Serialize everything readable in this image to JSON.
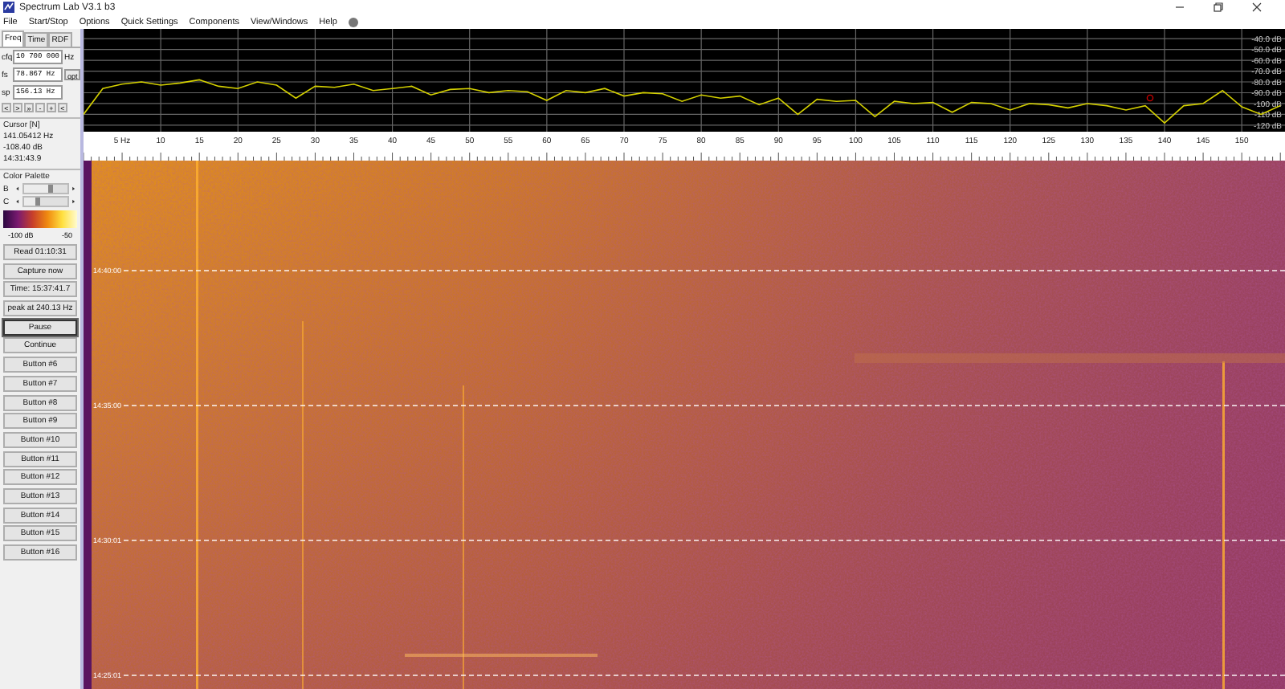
{
  "window": {
    "title": "Spectrum Lab V3.1 b3"
  },
  "menu": [
    "File",
    "Start/Stop",
    "Options",
    "Quick Settings",
    "Components",
    "View/Windows",
    "Help"
  ],
  "left_panel": {
    "tabs": [
      {
        "label": "Freq",
        "selected": true
      },
      {
        "label": "Time",
        "selected": false
      },
      {
        "label": "RDF",
        "selected": false
      }
    ],
    "fields": [
      {
        "label": "cfq",
        "value": "10 700 000",
        "suffix": "Hz"
      },
      {
        "label": "fs",
        "value": "78.867 Hz",
        "button": "opt"
      },
      {
        "label": "sp",
        "value": "156.13 Hz"
      }
    ],
    "nav_buttons": [
      "<",
      ">",
      "»",
      "-",
      "+",
      "<"
    ],
    "cursor": {
      "title": "Cursor [N]",
      "lines": [
        "141.05412 Hz",
        "-108.40 dB",
        "14:31:43.9"
      ]
    },
    "color_palette": {
      "title": "Color Palette",
      "sliders": [
        {
          "label": "B",
          "level": 0.68
        },
        {
          "label": "C",
          "level": 0.36
        }
      ],
      "scale_min": "-100 dB",
      "scale_max": "-50"
    },
    "buttons": [
      {
        "label": "Read 01:10:31",
        "default": false
      },
      {
        "label": "Capture now",
        "default": false
      },
      {
        "label": "Time:  15:37:41.7",
        "default": false
      },
      {
        "label": "peak at 240.13 Hz",
        "default": false
      },
      {
        "label": "Pause",
        "default": true
      },
      {
        "label": "Continue",
        "default": false
      },
      {
        "label": "Button #6",
        "default": false
      },
      {
        "label": "Button #7",
        "default": false
      },
      {
        "label": "Button #8",
        "default": false
      },
      {
        "label": "Button #9",
        "default": false
      },
      {
        "label": "Button #10",
        "default": false
      },
      {
        "label": "Button #11",
        "default": false
      },
      {
        "label": "Button #12",
        "default": false
      },
      {
        "label": "Button #13",
        "default": false
      },
      {
        "label": "Button #14",
        "default": false
      },
      {
        "label": "Button #15",
        "default": false
      },
      {
        "label": "Button #16",
        "default": false
      }
    ]
  },
  "spectrum": {
    "chart_data": {
      "type": "line",
      "x": [
        0,
        2.5,
        5,
        7.5,
        10,
        12.5,
        15,
        17.5,
        20,
        22.5,
        25,
        27.5,
        30,
        32.5,
        35,
        37.5,
        40,
        42.5,
        45,
        47.5,
        50,
        52.5,
        55,
        57.5,
        60,
        62.5,
        65,
        67.5,
        70,
        72.5,
        75,
        77.5,
        80,
        82.5,
        85,
        87.5,
        90,
        92.5,
        95,
        97.5,
        100,
        102.5,
        105,
        107.5,
        110,
        112.5,
        115,
        117.5,
        120,
        122.5,
        125,
        127.5,
        130,
        132.5,
        135,
        137.5,
        140,
        142.5,
        145,
        147.5,
        150,
        152.5,
        155
      ],
      "series": [
        {
          "color": "#d4d000",
          "values": [
            -110,
            -86,
            -82,
            -80,
            -83,
            -81,
            -78,
            -84,
            -86,
            -80,
            -83,
            -95,
            -84,
            -85,
            -82,
            -88,
            -86,
            -84,
            -92,
            -87,
            -86,
            -90,
            -88,
            -89,
            -97,
            -88,
            -90,
            -86,
            -93,
            -90,
            -91,
            -98,
            -92,
            -95,
            -93,
            -101,
            -95,
            -110,
            -96,
            -98,
            -97,
            -112,
            -98,
            -100,
            -99,
            -108,
            -99,
            -100,
            -106,
            -100,
            -101,
            -104,
            -100,
            -102,
            -106,
            -102,
            -118,
            -102,
            -100,
            -88,
            -103,
            -110,
            -102
          ]
        }
      ],
      "xlim": [
        0,
        155.6
      ],
      "ylim": [
        -126,
        -31
      ],
      "grid": true,
      "xticks": [
        {
          "value": 5,
          "label": "5 Hz"
        },
        10,
        15,
        20,
        25,
        30,
        35,
        40,
        45,
        50,
        55,
        60,
        65,
        70,
        75,
        80,
        85,
        90,
        95,
        100,
        105,
        110,
        115,
        120,
        125,
        130,
        135,
        140,
        145,
        150
      ],
      "yticks": [
        {
          "value": -40,
          "label": "-40.0 dB"
        },
        {
          "value": -50,
          "label": "-50.0 dB"
        },
        {
          "value": -60,
          "label": "-60.0 dB"
        },
        {
          "value": -70,
          "label": "-70.0 dB"
        },
        {
          "value": -80,
          "label": "-80.0 dB"
        },
        {
          "value": -90,
          "label": "-90.0 dB"
        },
        {
          "value": -100,
          "label": "-100 dB"
        },
        {
          "value": -110,
          "label": "-110 dB"
        },
        {
          "value": -120,
          "label": "-120 dB"
        }
      ]
    }
  },
  "waterfall": {
    "time_labels": [
      "14:40:00",
      "14:35:00",
      "14:30:01",
      "14:25:01"
    ]
  }
}
